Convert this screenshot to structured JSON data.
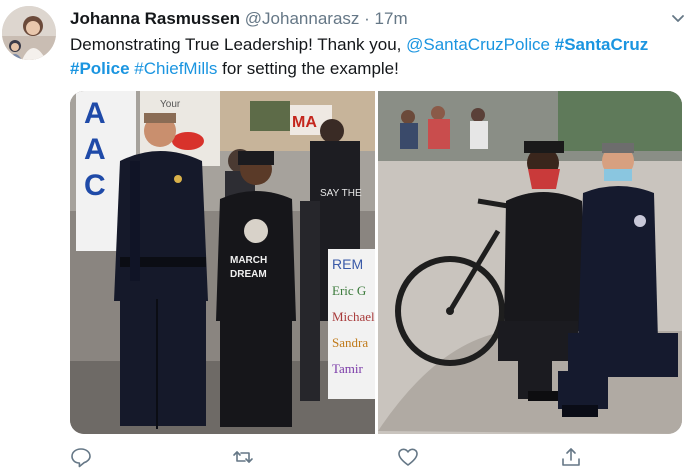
{
  "tweet": {
    "author_name": "Johanna Rasmussen",
    "author_handle": "@Johannarasz",
    "separator": "·",
    "time": "17m",
    "text_intro": "Demonstrating True Leadership! Thank you, ",
    "mention": "@SantaCruzPolice",
    "hashtag_1": "#SantaCruz",
    "hashtag_2": "#Police",
    "hashtag_3": "#ChiefMills",
    "text_outro": " for setting the example!"
  },
  "signs": {
    "left_banner": [
      "A",
      "A",
      "C"
    ],
    "march_shirt_line1": "MARCH",
    "march_shirt_line2": "DREAM",
    "sign_top": "MA",
    "sign_bottom_lines": [
      "REM",
      "Eric G",
      "Michael",
      "Sandra",
      "Tamir"
    ],
    "sign_top_small": "Your",
    "hoodie": "SAY THE"
  },
  "icons": {
    "reply": "reply-icon",
    "retweet": "retweet-icon",
    "like": "like-icon",
    "share": "share-icon",
    "more": "chevron-down-icon"
  },
  "colors": {
    "link": "#1b95e0",
    "text": "#14171a",
    "secondary": "#657786"
  }
}
